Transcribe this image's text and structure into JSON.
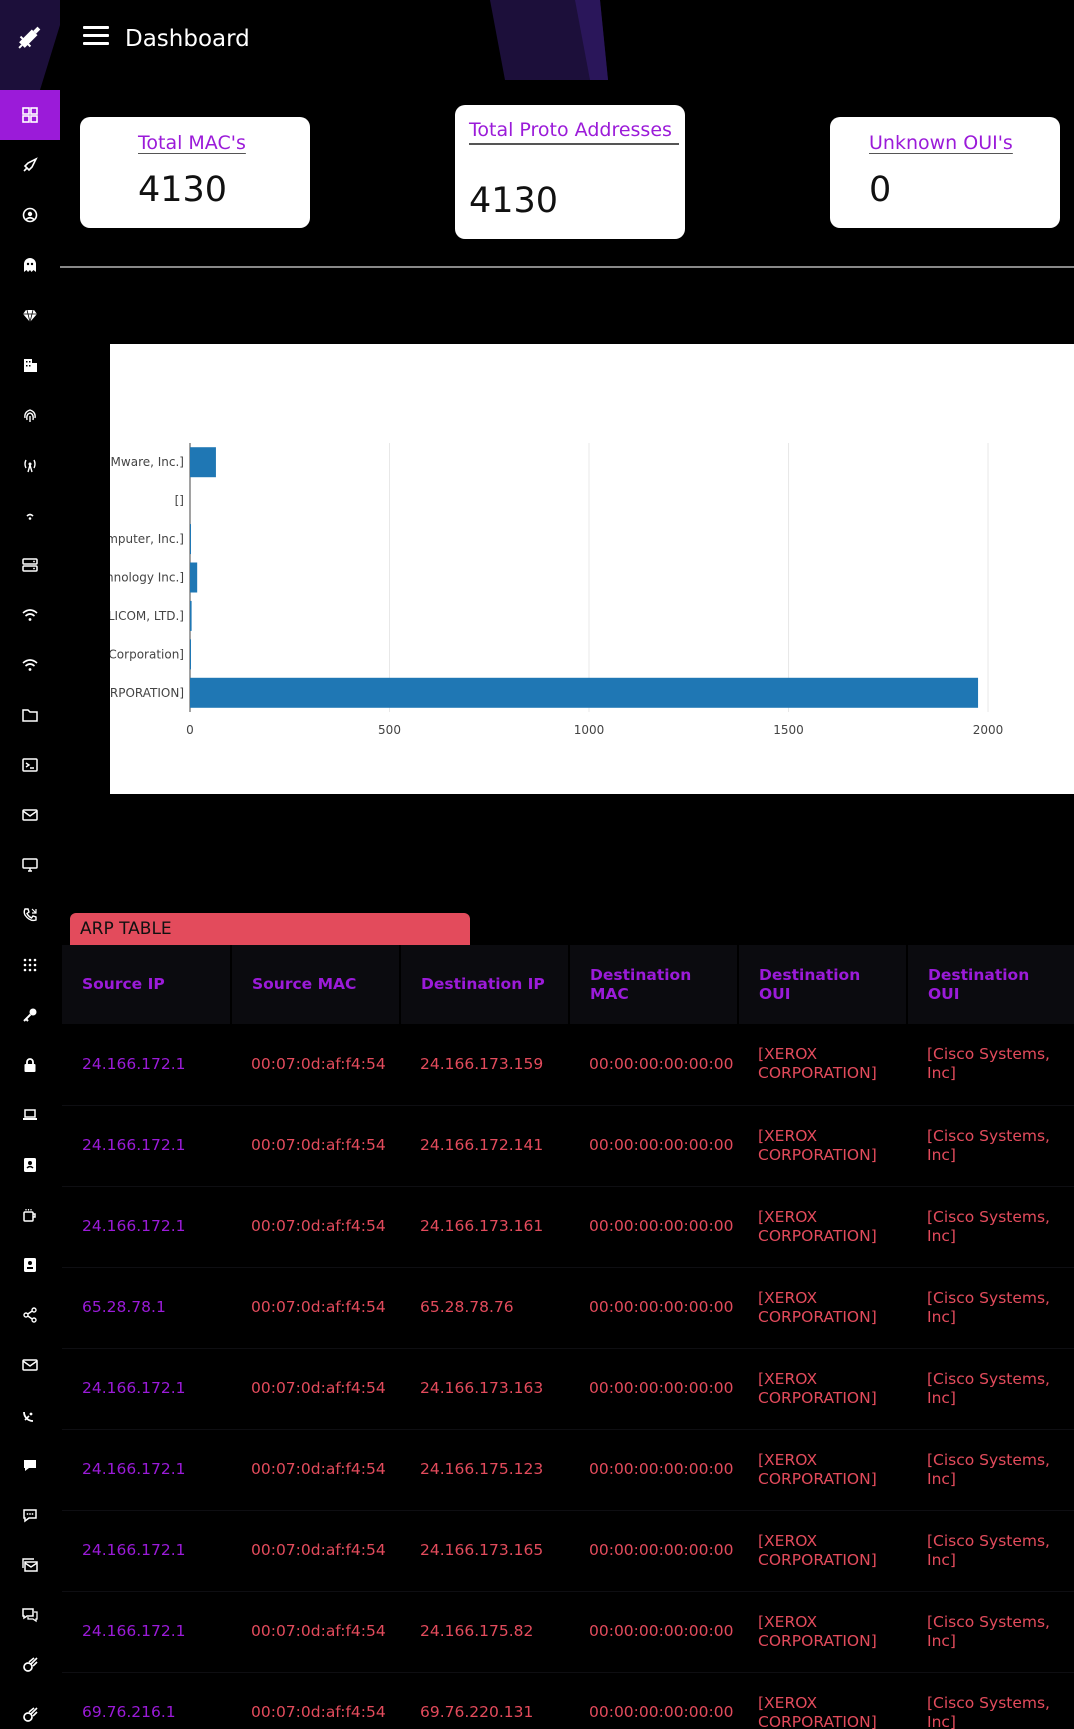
{
  "header": {
    "title": "Dashboard"
  },
  "sidebar": {
    "items": [
      {
        "icon": "dashboard-grid-icon",
        "active": true
      },
      {
        "icon": "rocket-icon"
      },
      {
        "icon": "user-circle-icon"
      },
      {
        "icon": "ghost-icon"
      },
      {
        "icon": "gem-icon"
      },
      {
        "icon": "building-icon"
      },
      {
        "icon": "fingerprint-icon"
      },
      {
        "icon": "broadcast-tower-icon"
      },
      {
        "icon": "wifi-small-icon"
      },
      {
        "icon": "server-icon"
      },
      {
        "icon": "wifi-icon"
      },
      {
        "icon": "wifi-icon"
      },
      {
        "icon": "folder-icon"
      },
      {
        "icon": "terminal-icon"
      },
      {
        "icon": "mail-icon"
      },
      {
        "icon": "desktop-icon"
      },
      {
        "icon": "phone-icon"
      },
      {
        "icon": "keypad-icon"
      },
      {
        "icon": "key-icon"
      },
      {
        "icon": "lock-icon"
      },
      {
        "icon": "laptop-icon"
      },
      {
        "icon": "id-badge-icon"
      },
      {
        "icon": "coffee-icon"
      },
      {
        "icon": "contact-card-icon"
      },
      {
        "icon": "share-icon"
      },
      {
        "icon": "mail-icon"
      },
      {
        "icon": "satellite-dish-icon"
      },
      {
        "icon": "comment-icon"
      },
      {
        "icon": "comment-dots-icon"
      },
      {
        "icon": "mail-bulk-icon"
      },
      {
        "icon": "comments-icon"
      },
      {
        "icon": "meteor-icon"
      },
      {
        "icon": "meteor-icon"
      }
    ]
  },
  "cards": {
    "mac": {
      "title": "Total MAC's",
      "value": "4130"
    },
    "proto": {
      "title": "Total Proto Addresses",
      "value": "4130"
    },
    "oui": {
      "title": "Unknown OUI's",
      "value": "0"
    }
  },
  "chart_data": {
    "type": "bar",
    "orientation": "horizontal",
    "categories": [
      "Mware, Inc.]",
      "[]",
      "mputer, Inc.]",
      "nnology Inc.]",
      "LICOM, LTD.]",
      "Corporation]",
      "RPORATION]"
    ],
    "values": [
      65,
      0,
      2,
      18,
      4,
      1,
      1975
    ],
    "x_ticks": [
      "0",
      "500",
      "1000",
      "1500",
      "2000"
    ],
    "xlim": [
      0,
      2030
    ],
    "grid": true,
    "bar_color": "#1f77b4"
  },
  "arp": {
    "tab_label": "ARP TABLE",
    "columns": [
      "Source IP",
      "Source MAC",
      "Destination IP",
      "Destination MAC",
      "Destination OUI",
      "Destination OUI"
    ],
    "rows": [
      [
        "24.166.172.1",
        "00:07:0d:af:f4:54",
        "24.166.173.159",
        "00:00:00:00:00:00",
        "[XEROX CORPORATION]",
        "[Cisco Systems, Inc]"
      ],
      [
        "24.166.172.1",
        "00:07:0d:af:f4:54",
        "24.166.172.141",
        "00:00:00:00:00:00",
        "[XEROX CORPORATION]",
        "[Cisco Systems, Inc]"
      ],
      [
        "24.166.172.1",
        "00:07:0d:af:f4:54",
        "24.166.173.161",
        "00:00:00:00:00:00",
        "[XEROX CORPORATION]",
        "[Cisco Systems, Inc]"
      ],
      [
        "65.28.78.1",
        "00:07:0d:af:f4:54",
        "65.28.78.76",
        "00:00:00:00:00:00",
        "[XEROX CORPORATION]",
        "[Cisco Systems, Inc]"
      ],
      [
        "24.166.172.1",
        "00:07:0d:af:f4:54",
        "24.166.173.163",
        "00:00:00:00:00:00",
        "[XEROX CORPORATION]",
        "[Cisco Systems, Inc]"
      ],
      [
        "24.166.172.1",
        "00:07:0d:af:f4:54",
        "24.166.175.123",
        "00:00:00:00:00:00",
        "[XEROX CORPORATION]",
        "[Cisco Systems, Inc]"
      ],
      [
        "24.166.172.1",
        "00:07:0d:af:f4:54",
        "24.166.173.165",
        "00:00:00:00:00:00",
        "[XEROX CORPORATION]",
        "[Cisco Systems, Inc]"
      ],
      [
        "24.166.172.1",
        "00:07:0d:af:f4:54",
        "24.166.175.82",
        "00:00:00:00:00:00",
        "[XEROX CORPORATION]",
        "[Cisco Systems, Inc]"
      ],
      [
        "69.76.216.1",
        "00:07:0d:af:f4:54",
        "69.76.220.131",
        "00:00:00:00:00:00",
        "[XEROX CORPORATION]",
        "[Cisco Systems, Inc]"
      ]
    ]
  },
  "colors": {
    "accent": "#9b1bd9",
    "danger": "#e34b5c",
    "bar": "#1f77b4"
  }
}
